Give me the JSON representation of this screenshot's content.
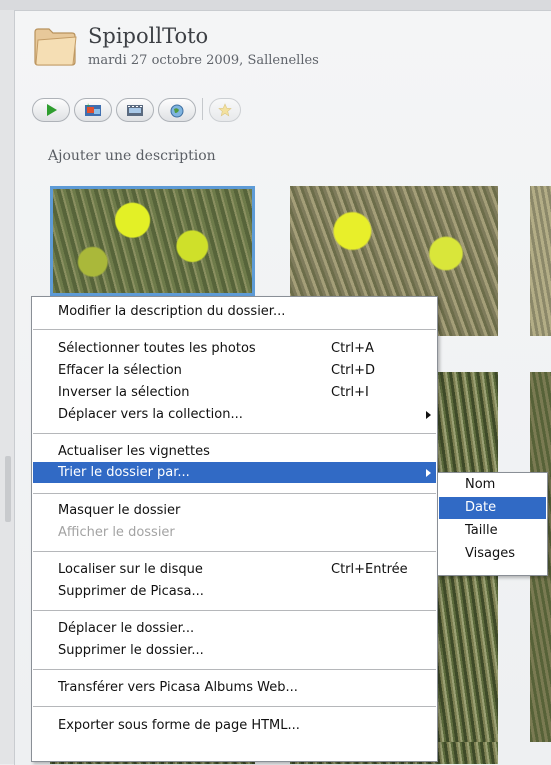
{
  "header": {
    "title": "SpipollToto",
    "subtitle": "mardi 27 octobre 2009, Sallenelles",
    "description_placeholder": "Ajouter une description"
  },
  "toolbar": {
    "buttons": [
      {
        "icon": "play-slideshow-icon"
      },
      {
        "icon": "photo-collage-icon"
      },
      {
        "icon": "movie-film-icon"
      },
      {
        "icon": "globe-geotag-icon"
      },
      {
        "icon": "star-icon"
      }
    ]
  },
  "context_menu": {
    "items": [
      {
        "label": "Modifier la description du dossier...",
        "shortcut": ""
      },
      {
        "label": "Sélectionner toutes les photos",
        "shortcut": "Ctrl+A"
      },
      {
        "label": "Effacer la sélection",
        "shortcut": "Ctrl+D"
      },
      {
        "label": "Inverser la sélection",
        "shortcut": "Ctrl+I"
      },
      {
        "label": "Déplacer vers la collection...",
        "shortcut": ""
      },
      {
        "label": "Actualiser les vignettes",
        "shortcut": ""
      },
      {
        "label": "Trier le dossier par...",
        "shortcut": ""
      },
      {
        "label": "Masquer le dossier",
        "shortcut": ""
      },
      {
        "label": "Afficher le dossier",
        "shortcut": ""
      },
      {
        "label": "Localiser sur le disque",
        "shortcut": "Ctrl+Entrée"
      },
      {
        "label": "Supprimer de Picasa...",
        "shortcut": ""
      },
      {
        "label": "Déplacer le dossier...",
        "shortcut": ""
      },
      {
        "label": "Supprimer le dossier...",
        "shortcut": ""
      },
      {
        "label": "Transférer vers Picasa Albums Web...",
        "shortcut": ""
      },
      {
        "label": "Exporter sous forme de page HTML...",
        "shortcut": ""
      }
    ],
    "highlighted": "Trier le dossier par...",
    "disabled": [
      "Afficher le dossier"
    ]
  },
  "sort_submenu": {
    "items": [
      "Nom",
      "Date",
      "Taille",
      "Visages"
    ],
    "highlighted": "Date"
  },
  "colors": {
    "highlight": "#316ac5",
    "selection_border": "#5e9bd6"
  }
}
